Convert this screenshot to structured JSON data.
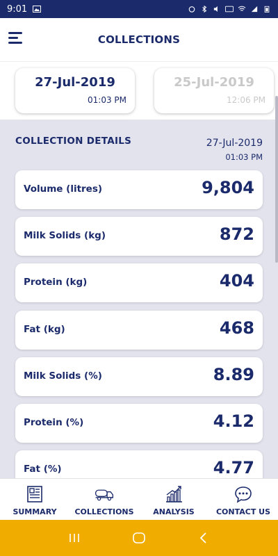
{
  "status_bar": {
    "time": "9:01"
  },
  "header": {
    "title": "COLLECTIONS"
  },
  "date_tabs": [
    {
      "date": "27-Jul-2019",
      "time": "01:03 PM",
      "active": true
    },
    {
      "date": "25-Jul-2019",
      "time": "12:06 PM",
      "active": false
    }
  ],
  "details": {
    "title": "COLLECTION DETAILS",
    "date": "27-Jul-2019",
    "time": "01:03 PM",
    "items": [
      {
        "label": "Volume (litres)",
        "value": "9,804"
      },
      {
        "label": "Milk Solids (kg)",
        "value": "872"
      },
      {
        "label": "Protein (kg)",
        "value": "404"
      },
      {
        "label": "Fat (kg)",
        "value": "468"
      },
      {
        "label": "Milk Solids (%)",
        "value": "8.89"
      },
      {
        "label": "Protein (%)",
        "value": "4.12"
      },
      {
        "label": "Fat (%)",
        "value": "4.77"
      }
    ]
  },
  "bottom_nav": [
    {
      "label": "SUMMARY",
      "icon": "summary-icon"
    },
    {
      "label": "COLLECTIONS",
      "icon": "tanker-icon"
    },
    {
      "label": "ANALYSIS",
      "icon": "analysis-icon"
    },
    {
      "label": "CONTACT US",
      "icon": "chat-icon"
    }
  ],
  "colors": {
    "primary": "#1b2a6b",
    "accent": "#f0ad00",
    "inactive": "#c9c9c9",
    "background": "#e3e3ee"
  }
}
